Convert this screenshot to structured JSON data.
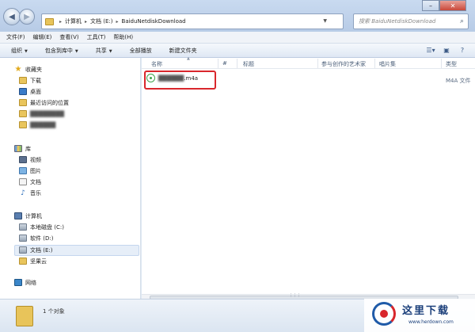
{
  "window": {
    "address": {
      "crumbs": [
        "计算机",
        "文档 (E:)",
        "BaiduNetdiskDownload"
      ]
    },
    "search": {
      "placeholder": "搜索 BaiduNetdiskDownload"
    },
    "controls": {
      "minimize": "–",
      "maximize": "□",
      "close": "✕"
    }
  },
  "menubar": {
    "items": [
      "文件(F)",
      "编辑(E)",
      "查看(V)",
      "工具(T)",
      "帮助(H)"
    ]
  },
  "toolbar": {
    "organize": "组织",
    "include_library": "包含到库中",
    "share": "共享",
    "play_all": "全部播放",
    "new_folder": "新建文件夹"
  },
  "navpane": {
    "favorites": {
      "header": "收藏夹",
      "items": [
        "下载",
        "桌面",
        "最近访问的位置",
        "████████",
        "██████"
      ]
    },
    "libraries": {
      "header": "库",
      "items": [
        "视频",
        "图片",
        "文档",
        "音乐"
      ]
    },
    "computer": {
      "header": "计算机",
      "items": [
        "本地磁盘 (C:)",
        "软件 (D:)",
        "文档 (E:)",
        "坚果云"
      ]
    },
    "network": {
      "header": "网络"
    }
  },
  "columns": [
    "名称",
    "#",
    "标题",
    "参与创作的艺术家",
    "唱片集",
    "类型"
  ],
  "files": [
    {
      "name_hidden": "██████",
      "ext": ".m4a",
      "type": "M4A 文件"
    }
  ],
  "status": {
    "count": "1 个对象"
  },
  "watermark": {
    "title": "这里下载",
    "url": "www.herdown.com"
  }
}
